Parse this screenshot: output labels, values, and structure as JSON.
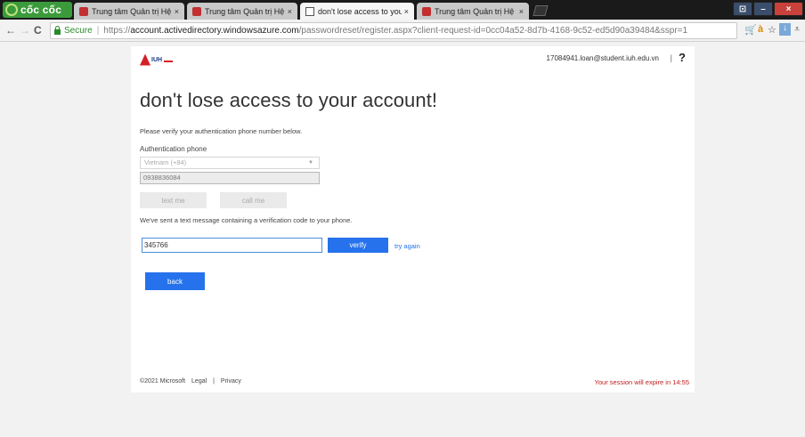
{
  "browser": {
    "brand": "cốc cốc",
    "tabs": [
      {
        "label": "Trung tâm Quản trị Hệ thố",
        "close": "×"
      },
      {
        "label": "Trung tâm Quản trị Hệ thố",
        "close": "×"
      },
      {
        "label": "don't lose access to your a",
        "close": "×"
      },
      {
        "label": "Trung tâm Quản trị Hệ thố",
        "close": "×"
      }
    ],
    "nav": {
      "back": "←",
      "forward": "→",
      "reload": "C"
    },
    "secure_label": "Secure",
    "url_scheme": "https://",
    "url_host": "account.activedirectory.windowsazure.com",
    "url_path": "/passwordreset/register.aspx?client-request-id=0cc04a52-8d7b-4168-9c52-ed5d90a39484&sspr=1",
    "window_controls": {
      "sys": "⊡",
      "minimize": "–",
      "close": "×"
    }
  },
  "header": {
    "logo_text": "IUH",
    "user_email": "17084941.loan@student.iuh.edu.vn",
    "separator": "|",
    "help": "?"
  },
  "main": {
    "heading": "don't lose access to your account!",
    "instruction": "Please verify your authentication phone number below.",
    "auth_label": "Authentication phone",
    "country": "Vietnam (+84)",
    "phone": "0938836084",
    "text_me": "text me",
    "call_me": "call me",
    "sent_message": "We've sent a text message containing a verification code to your phone.",
    "code": "345766",
    "verify": "verify",
    "try_again": "try again",
    "back": "back"
  },
  "footer": {
    "copyright": "©2021 Microsoft",
    "legal": "Legal",
    "sep": "|",
    "privacy": "Privacy",
    "session": "Your session will expire in 14:55"
  },
  "colors": {
    "accent": "#2672ec",
    "warning": "#c02020",
    "secure": "#2a8a2a"
  }
}
